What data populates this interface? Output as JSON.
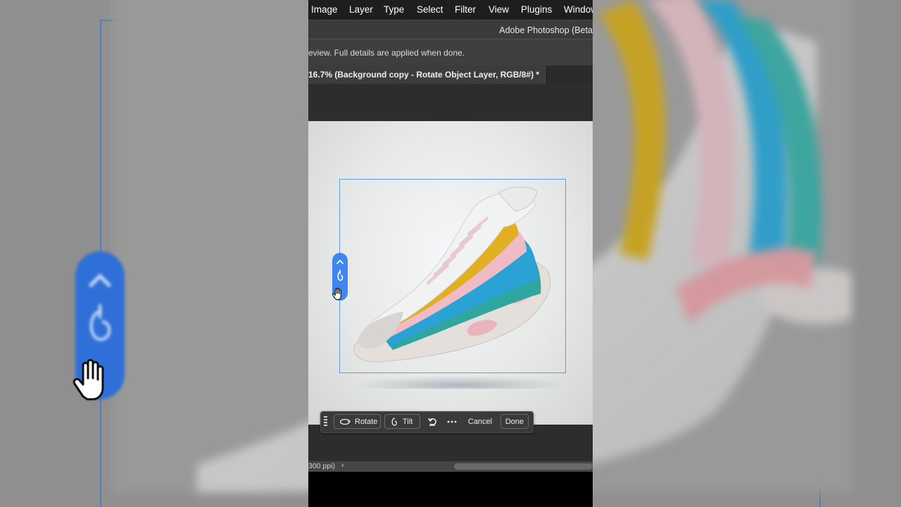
{
  "menu": {
    "items": [
      "Image",
      "Layer",
      "Type",
      "Select",
      "Filter",
      "View",
      "Plugins",
      "Window"
    ]
  },
  "titlebar": {
    "app_title": "Adobe Photoshop (Beta"
  },
  "notice": {
    "text": "eview. Full details are applied when done."
  },
  "document_tab": {
    "title": "16.7% (Background copy - Rotate Object Layer, RGB/8#) *"
  },
  "taskbar": {
    "rotate_label": "Rotate",
    "tilt_label": "Tilt",
    "cancel_label": "Cancel",
    "done_label": "Done"
  },
  "statusbar": {
    "resolution_text": "300 ppi)",
    "chevron": "›"
  },
  "colors": {
    "accent": "#3d87ee",
    "selection": "#5f9be6",
    "menubar": "#1e1e1e",
    "panel": "#3a3a3a"
  },
  "icons": [
    "chevron-up-icon",
    "rotate-object-icon",
    "hand-cursor-icon",
    "rotate-icon",
    "tilt-icon",
    "undo-icon",
    "more-options-icon",
    "grip-icon"
  ]
}
